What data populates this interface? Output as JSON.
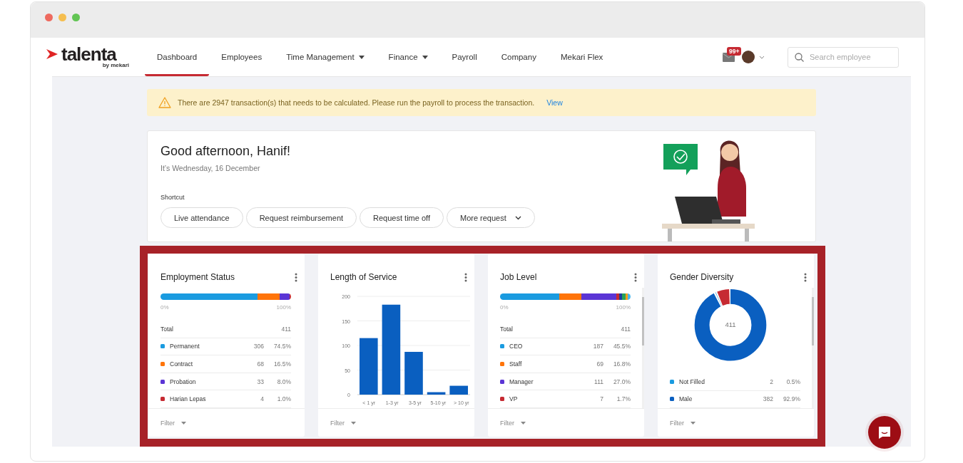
{
  "nav": {
    "logo": {
      "name": "talenta",
      "tagline": "by mekari"
    },
    "items": [
      {
        "label": "Dashboard",
        "selected": true,
        "dropdown": false
      },
      {
        "label": "Employees",
        "selected": false,
        "dropdown": false
      },
      {
        "label": "Time Management",
        "selected": false,
        "dropdown": true
      },
      {
        "label": "Finance",
        "selected": false,
        "dropdown": true
      },
      {
        "label": "Payroll",
        "selected": false,
        "dropdown": false
      },
      {
        "label": "Company",
        "selected": false,
        "dropdown": false
      },
      {
        "label": "Mekari Flex",
        "selected": false,
        "dropdown": false
      }
    ],
    "notification_badge": "99+",
    "search": {
      "placeholder": "Search employee"
    }
  },
  "banner": {
    "message": "There are 2947 transaction(s) that needs to be calculated. Please run the payroll to process the transaction.",
    "link": "View"
  },
  "greeting": {
    "title": "Good afternoon, Hanif!",
    "date": "It’s Wednesday, 16 December",
    "shortcut_label": "Shortcut",
    "shortcuts": [
      {
        "label": "Live attendance",
        "dropdown": false
      },
      {
        "label": "Request reimbursement",
        "dropdown": false
      },
      {
        "label": "Request time off",
        "dropdown": false
      },
      {
        "label": "More request",
        "dropdown": true
      }
    ]
  },
  "widgets": [
    {
      "kind": "stacked",
      "title": "Employment Status",
      "scrollable": false,
      "scale_start": "0%",
      "scale_end": "100%",
      "total_label": "Total",
      "total": "411",
      "filter": "Filter",
      "rows": [
        {
          "label": "Permanent",
          "count": "306",
          "percent": "74.5%",
          "color": "#1a9be0"
        },
        {
          "label": "Contract",
          "count": "68",
          "percent": "16.5%",
          "color": "#ff7409"
        },
        {
          "label": "Probation",
          "count": "33",
          "percent": "8.0%",
          "color": "#5b35d5"
        },
        {
          "label": "Harian Lepas",
          "count": "4",
          "percent": "1.0%",
          "color": "#c62a32"
        }
      ]
    },
    {
      "kind": "bar",
      "title": "Length of Service",
      "filter": "Filter",
      "chart_data": {
        "type": "bar",
        "categories": [
          "< 1 yr",
          "1-3 yr",
          "3-5 yr",
          "5-10 yr",
          "> 10 yr"
        ],
        "values": [
          115,
          183,
          87,
          5,
          18
        ],
        "grid": true,
        "ylim": [
          0,
          200
        ],
        "yticks": [
          0,
          50,
          100,
          150,
          200
        ]
      }
    },
    {
      "kind": "stacked",
      "title": "Job Level",
      "scrollable": true,
      "scale_start": "0%",
      "scale_end": "100%",
      "total_label": "Total",
      "total": "411",
      "filter": "Filter",
      "rows": [
        {
          "label": "CEO",
          "count": "187",
          "percent": "45.5%",
          "color": "#1a9be0"
        },
        {
          "label": "Staff",
          "count": "69",
          "percent": "16.8%",
          "color": "#ff7409"
        },
        {
          "label": "Manager",
          "count": "111",
          "percent": "27.0%",
          "color": "#5b35d5"
        },
        {
          "label": "VP",
          "count": "7",
          "percent": "1.7%",
          "color": "#c62a32"
        }
      ]
    },
    {
      "kind": "donut",
      "title": "Gender Diversity",
      "scrollable": true,
      "center": "411",
      "filter": "Filter",
      "rows": [
        {
          "label": "Not Filled",
          "count": "2",
          "percent": "0.5%",
          "color": "#1a9be0"
        },
        {
          "label": "Male",
          "count": "382",
          "percent": "92.9%",
          "color": "#0a5fc0"
        }
      ]
    }
  ]
}
